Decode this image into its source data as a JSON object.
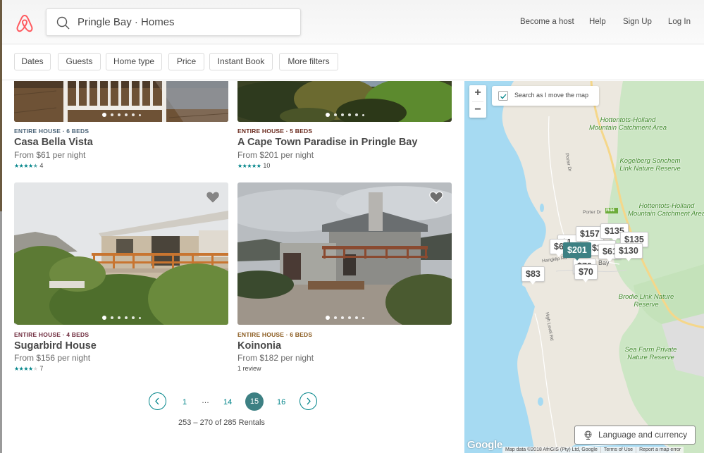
{
  "header": {
    "logo": "airbnb-logo",
    "search_value": "Pringle Bay · Homes",
    "nav": [
      "Become a host",
      "Help",
      "Sign Up",
      "Log In"
    ]
  },
  "filters": [
    "Dates",
    "Guests",
    "Home type",
    "Price",
    "Instant Book",
    "More filters"
  ],
  "listings": [
    {
      "kind": "ENTIRE HOUSE · 6 BEDS",
      "kind_color": "#4b6478",
      "title": "Casa Bella Vista",
      "price": "From $61 per night",
      "rating_stars": 4.5,
      "reviews": "4"
    },
    {
      "kind": "ENTIRE HOUSE · 5 BEDS",
      "kind_color": "#6b2b1e",
      "title": "A Cape Town Paradise in Pringle Bay",
      "price": "From $201 per night",
      "rating_stars": 5,
      "reviews": "10"
    },
    {
      "kind": "ENTIRE HOUSE · 4 BEDS",
      "kind_color": "#6e2a3c",
      "title": "Sugarbird House",
      "price": "From $156 per night",
      "rating_stars": 4,
      "reviews": "7"
    },
    {
      "kind": "ENTIRE HOUSE · 6 BEDS",
      "kind_color": "#8a5a1e",
      "title": "Koinonia",
      "price": "From $182 per night",
      "rating_stars": null,
      "reviews": "1 review"
    }
  ],
  "pagination": {
    "pages": [
      "1",
      "…",
      "14",
      "15",
      "16"
    ],
    "current": "15",
    "results_text": "253 – 270 of 285 Rentals"
  },
  "map": {
    "zoom_in": "+",
    "zoom_out": "−",
    "search_as_move_label": "Search as I move the map",
    "search_as_move_checked": true,
    "areas": [
      "Hottentots-Holland Mountain Catchment Area",
      "Kogelberg Sonchem Link Nature Reserve",
      "Hottentots-Holland Mountain Catchment Area",
      "Brodie Link Nature Reserve",
      "Sea Farm Private Nature Reserve"
    ],
    "roads": [
      "Porter Dr",
      "Porter Dr",
      "R44",
      "Hangklip Rd",
      "High Level Rd",
      "Bay"
    ],
    "price_pins": [
      "$157",
      "$135",
      "$135",
      "$6",
      "$201",
      "$61",
      "$130",
      "$70",
      "$70",
      "$83"
    ],
    "active_pin": "$201",
    "language_button": "Language and currency",
    "google_logo": "Google",
    "attribution": [
      "Map data ©2018 AfriGIS (Pty) Ltd, Google",
      "Terms of Use",
      "Report a map error"
    ]
  }
}
